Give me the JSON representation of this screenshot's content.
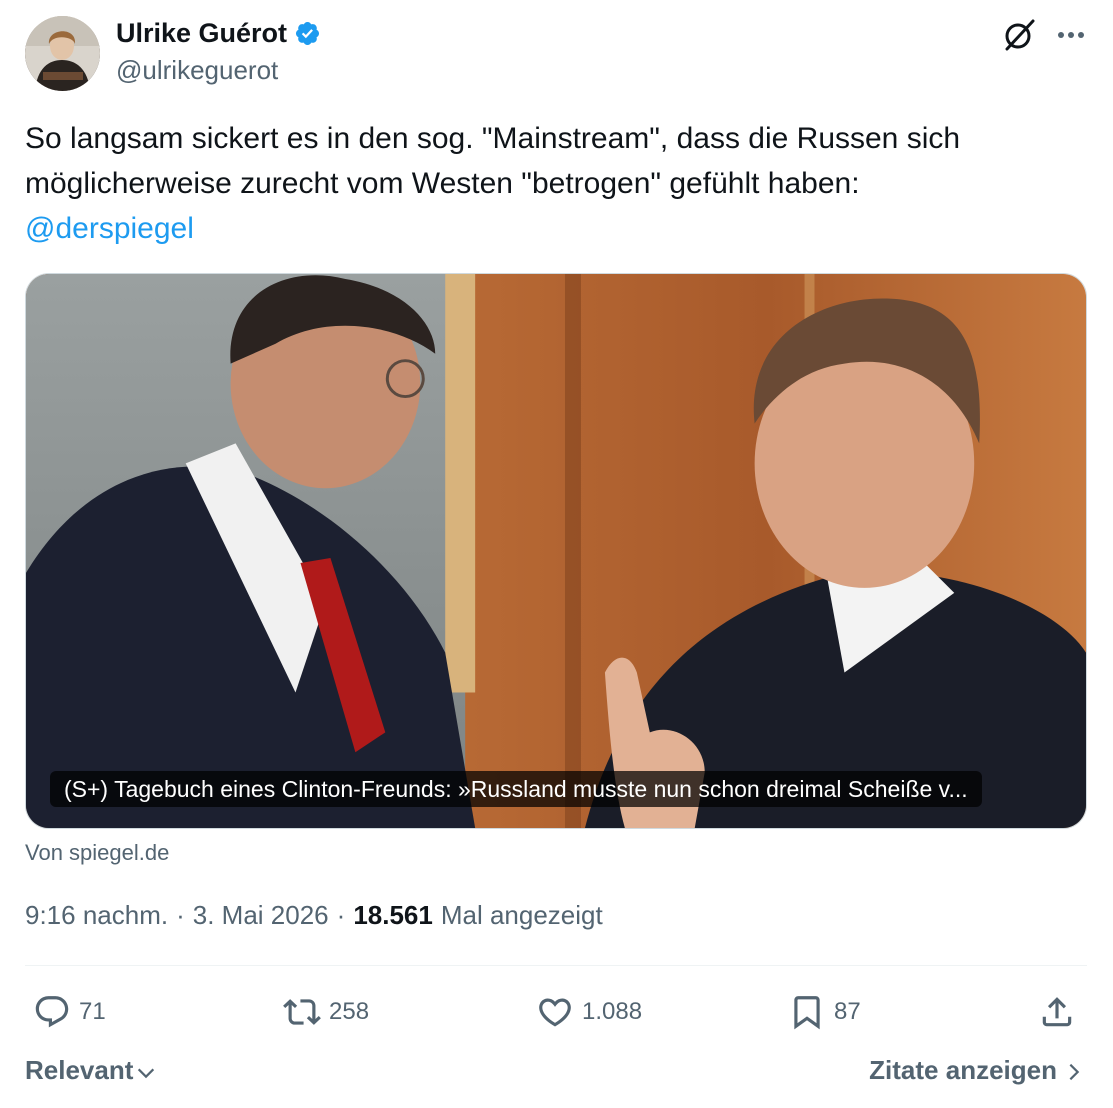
{
  "author": {
    "display_name": "Ulrike Guérot",
    "handle": "@ulrikeguerot",
    "verified_color": "#1d9bf0"
  },
  "icons": {
    "grok": "grok-icon",
    "more": "more-icon"
  },
  "tweet": {
    "text_line1": "So langsam sickert es in den sog. \"Mainstream\", dass die Russen sich",
    "text_line2": "möglicherweise zurecht vom Westen \"betrogen\" gefühlt haben:",
    "mention": "@derspiegel"
  },
  "card": {
    "caption": "(S+) Tagebuch eines Clinton-Freunds: »Russland musste nun schon dreimal Scheiße v...",
    "source": "Von spiegel.de"
  },
  "meta": {
    "time": "9:16 nachm.",
    "separator": "·",
    "date": "3. Mai 2026",
    "views_count": "18.561",
    "views_label": "Mal angezeigt"
  },
  "actions": {
    "replies": "71",
    "retweets": "258",
    "likes": "1.088",
    "bookmarks": "87"
  },
  "footer": {
    "sort_label": "Relevant",
    "quotes_label": "Zitate anzeigen"
  },
  "colors": {
    "link": "#1d9bf0",
    "secondary_text": "#536471",
    "primary_text": "#0f1419"
  }
}
